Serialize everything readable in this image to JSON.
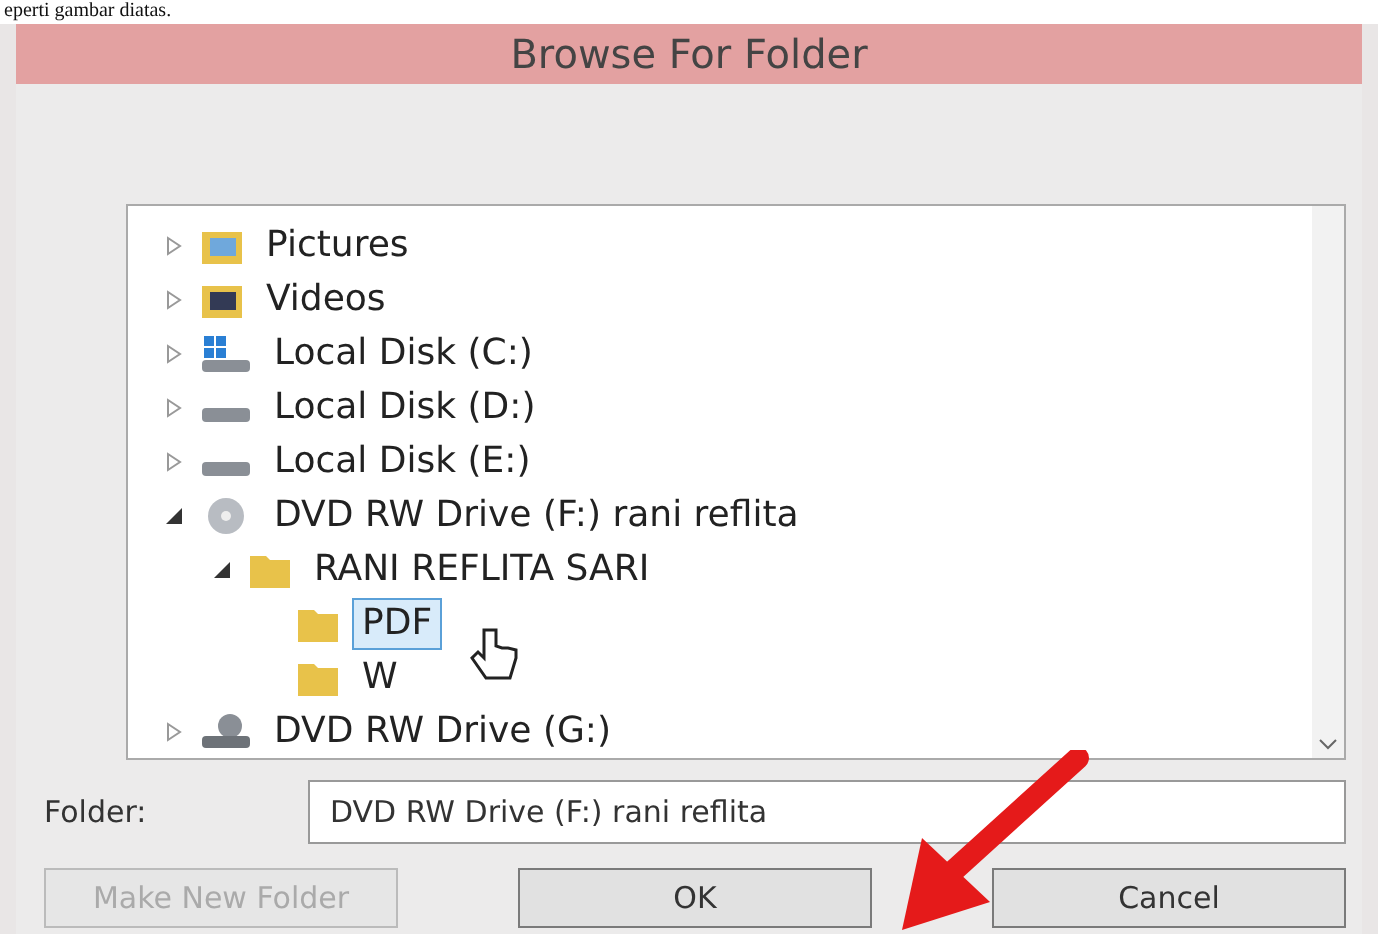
{
  "document_text": "eperti gambar diatas.",
  "window": {
    "title": "Browse For Folder"
  },
  "tree": [
    {
      "label": "Pictures",
      "kind": "pictures",
      "expanded": false,
      "selected": false
    },
    {
      "label": "Videos",
      "kind": "videos",
      "expanded": false,
      "selected": false
    },
    {
      "label": "Local Disk (C:)",
      "kind": "system-disk",
      "expanded": false,
      "selected": false
    },
    {
      "label": "Local Disk (D:)",
      "kind": "disk",
      "expanded": false,
      "selected": false
    },
    {
      "label": "Local Disk (E:)",
      "kind": "disk",
      "expanded": false,
      "selected": false
    },
    {
      "label": "DVD RW Drive (F:) rani reflita",
      "kind": "dvd",
      "expanded": true,
      "selected": false,
      "children": [
        {
          "label": "RANI REFLITA SARI",
          "kind": "folder",
          "expanded": true,
          "selected": false,
          "children": [
            {
              "label": "PDF",
              "kind": "folder",
              "selected": true
            },
            {
              "label": "W",
              "kind": "folder",
              "selected": false
            }
          ]
        }
      ]
    },
    {
      "label": "DVD RW Drive (G:)",
      "kind": "dvd-net",
      "expanded": false,
      "selected": false
    }
  ],
  "folder_field": {
    "label": "Folder:",
    "value": "DVD RW Drive (F:) rani reflita"
  },
  "buttons": [
    {
      "label": "Make New Folder",
      "disabled": true
    },
    {
      "label": "OK",
      "disabled": false
    },
    {
      "label": "Cancel",
      "disabled": false
    }
  ]
}
